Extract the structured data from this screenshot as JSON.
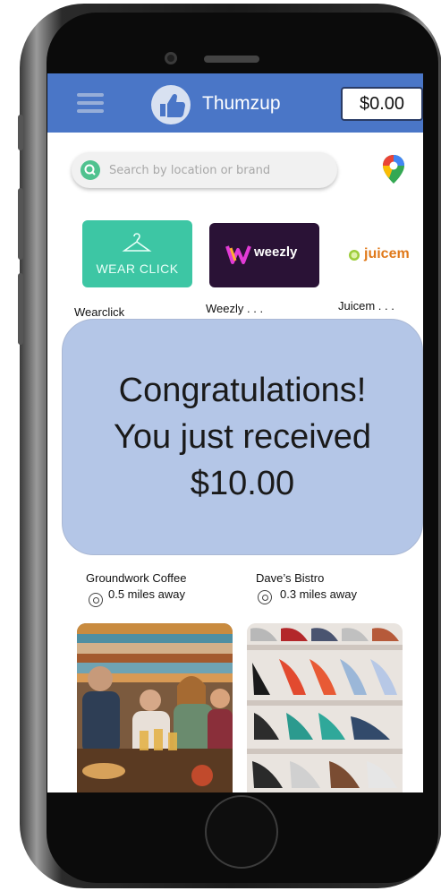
{
  "header": {
    "app_title": "Thumzup",
    "wallet_balance": "$0.00",
    "brand_color": "#4a76c7"
  },
  "search": {
    "placeholder": "Search by location or brand"
  },
  "brands": [
    {
      "logo_text": "WEAR CLICK",
      "label": "Wearclick"
    },
    {
      "logo_text": "weezly",
      "label": "Weezly . . ."
    },
    {
      "logo_text": "juicem",
      "label": "Juicem . . ."
    }
  ],
  "congrats": {
    "line1": "Congratulations!",
    "line2": "You just received",
    "amount": "$10.00",
    "background": "#b4c6e7"
  },
  "places": [
    {
      "name": "Groundwork Coffee",
      "distance": "0.5 miles away"
    },
    {
      "name": "Dave’s Bistro",
      "distance": "0.3 miles away"
    }
  ],
  "icons": [
    "menu-icon",
    "thumbs-up-icon",
    "search-icon",
    "map-pin-icon",
    "location-icon",
    "hanger-icon",
    "lime-icon"
  ]
}
